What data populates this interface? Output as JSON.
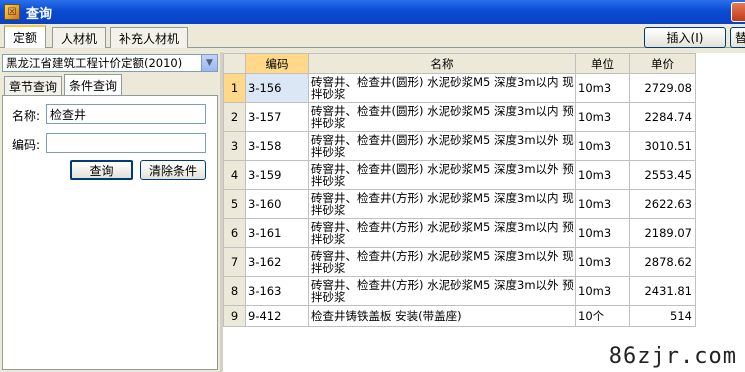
{
  "window": {
    "title": "查询",
    "app_icon_glyph": "☒"
  },
  "top_tabs": [
    {
      "label": "定额",
      "active": true
    },
    {
      "label": "人材机",
      "active": false
    },
    {
      "label": "补充人材机",
      "active": false
    }
  ],
  "toolbar": {
    "insert_label": "插入(I)",
    "replace_label": "替"
  },
  "left": {
    "library_select": "黑龙江省建筑工程计价定额(2010)",
    "sub_tabs": [
      {
        "label": "章节查询",
        "active": false
      },
      {
        "label": "条件查询",
        "active": true
      }
    ],
    "name_label": "名称:",
    "name_value": "检查井",
    "code_label": "编码:",
    "code_value": "",
    "query_button": "查询",
    "clear_button": "清除条件"
  },
  "grid": {
    "headers": {
      "code": "编码",
      "name": "名称",
      "unit": "单位",
      "price": "单价"
    },
    "rows": [
      {
        "n": "1",
        "code": "3-156",
        "name": "砖窨井、检查井(圆形) 水泥砂浆M5 深度3m以内 现拌砂浆",
        "unit": "10m3",
        "price": "2729.08"
      },
      {
        "n": "2",
        "code": "3-157",
        "name": "砖窨井、检查井(圆形) 水泥砂浆M5 深度3m以内 预拌砂浆",
        "unit": "10m3",
        "price": "2284.74"
      },
      {
        "n": "3",
        "code": "3-158",
        "name": "砖窨井、检查井(圆形) 水泥砂浆M5 深度3m以外 现拌砂浆",
        "unit": "10m3",
        "price": "3010.51"
      },
      {
        "n": "4",
        "code": "3-159",
        "name": "砖窨井、检查井(圆形) 水泥砂浆M5 深度3m以外 预拌砂浆",
        "unit": "10m3",
        "price": "2553.45"
      },
      {
        "n": "5",
        "code": "3-160",
        "name": "砖窨井、检查井(方形) 水泥砂浆M5 深度3m以内 现拌砂浆",
        "unit": "10m3",
        "price": "2622.63"
      },
      {
        "n": "6",
        "code": "3-161",
        "name": "砖窨井、检查井(方形) 水泥砂浆M5 深度3m以内 预拌砂浆",
        "unit": "10m3",
        "price": "2189.07"
      },
      {
        "n": "7",
        "code": "3-162",
        "name": "砖窨井、检查井(方形) 水泥砂浆M5 深度3m以外 现拌砂浆",
        "unit": "10m3",
        "price": "2878.62"
      },
      {
        "n": "8",
        "code": "3-163",
        "name": "砖窨井、检查井(方形) 水泥砂浆M5 深度3m以外 预拌砂浆",
        "unit": "10m3",
        "price": "2431.81"
      },
      {
        "n": "9",
        "code": "9-412",
        "name": "检查井铸铁盖板 安装(带盖座)",
        "unit": "10个",
        "price": "514"
      }
    ]
  },
  "watermark": "86zjr.com",
  "colors": {
    "titlebar": "#0a4bd3",
    "selected_header": "#ffd88a",
    "tab_highlight": "#ffc83c"
  }
}
